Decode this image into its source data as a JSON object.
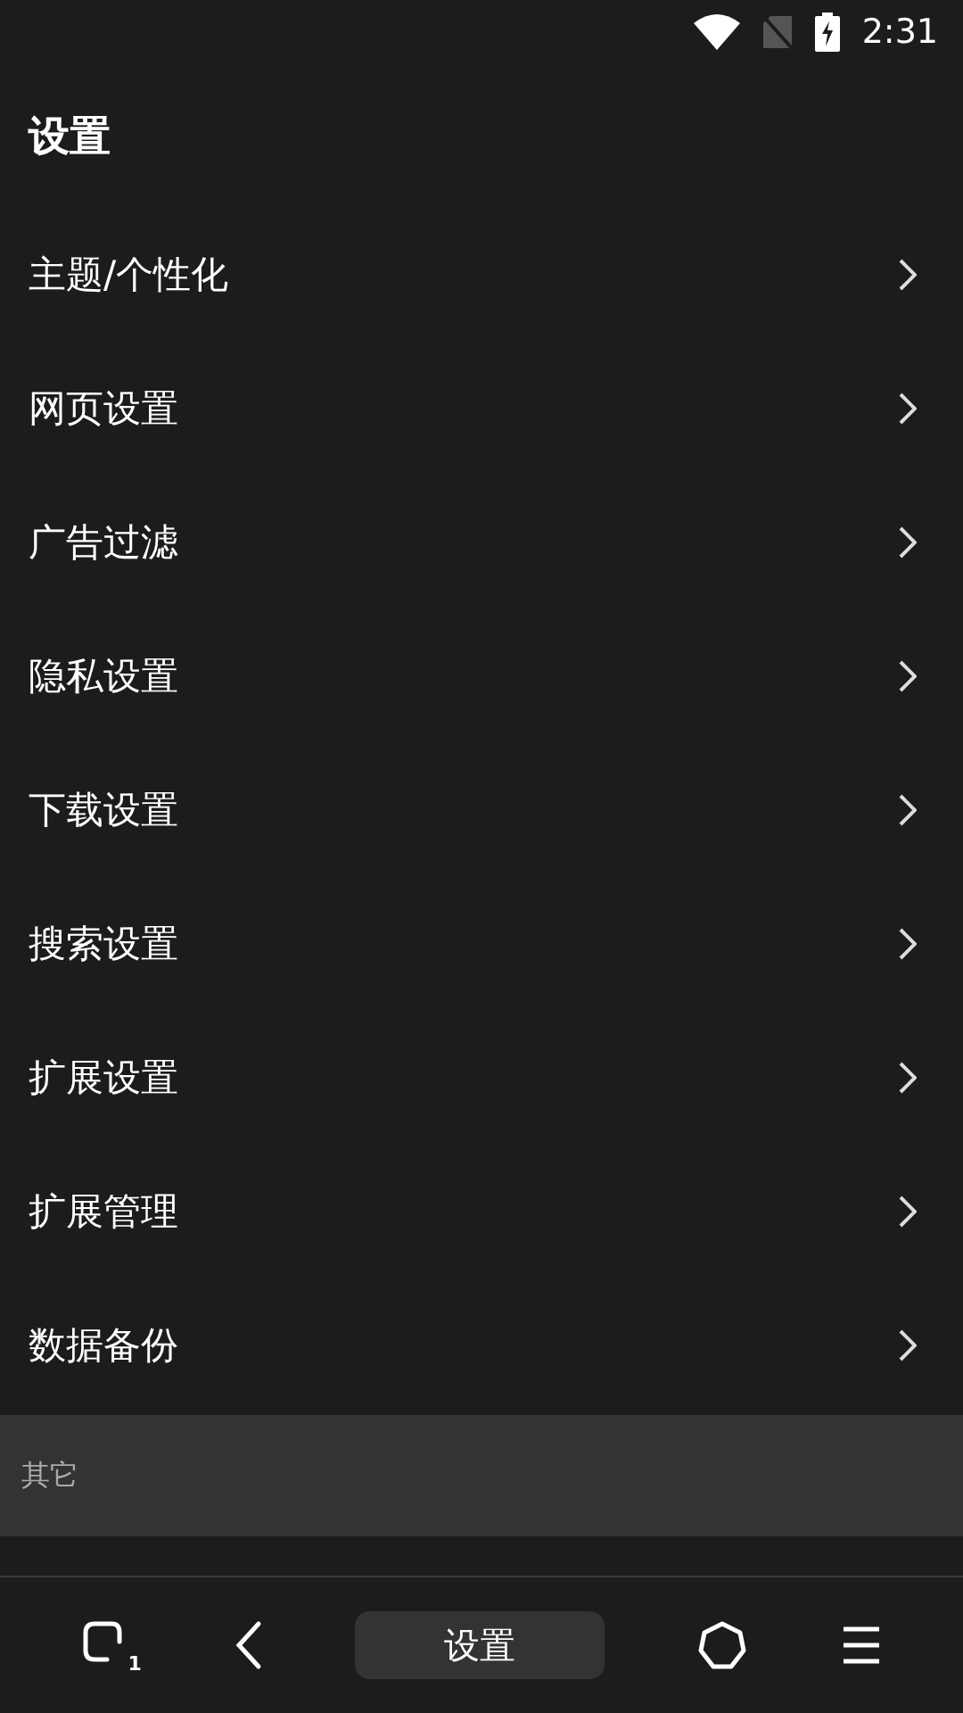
{
  "status_bar": {
    "time": "2:31"
  },
  "title": "设置",
  "items": [
    {
      "label": "主题/个性化"
    },
    {
      "label": "网页设置"
    },
    {
      "label": "广告过滤"
    },
    {
      "label": "隐私设置"
    },
    {
      "label": "下载设置"
    },
    {
      "label": "搜索设置"
    },
    {
      "label": "扩展设置"
    },
    {
      "label": "扩展管理"
    },
    {
      "label": "数据备份"
    }
  ],
  "section": {
    "title": "其它"
  },
  "bottom_bar": {
    "tab_count": "1",
    "current_page": "设置"
  }
}
